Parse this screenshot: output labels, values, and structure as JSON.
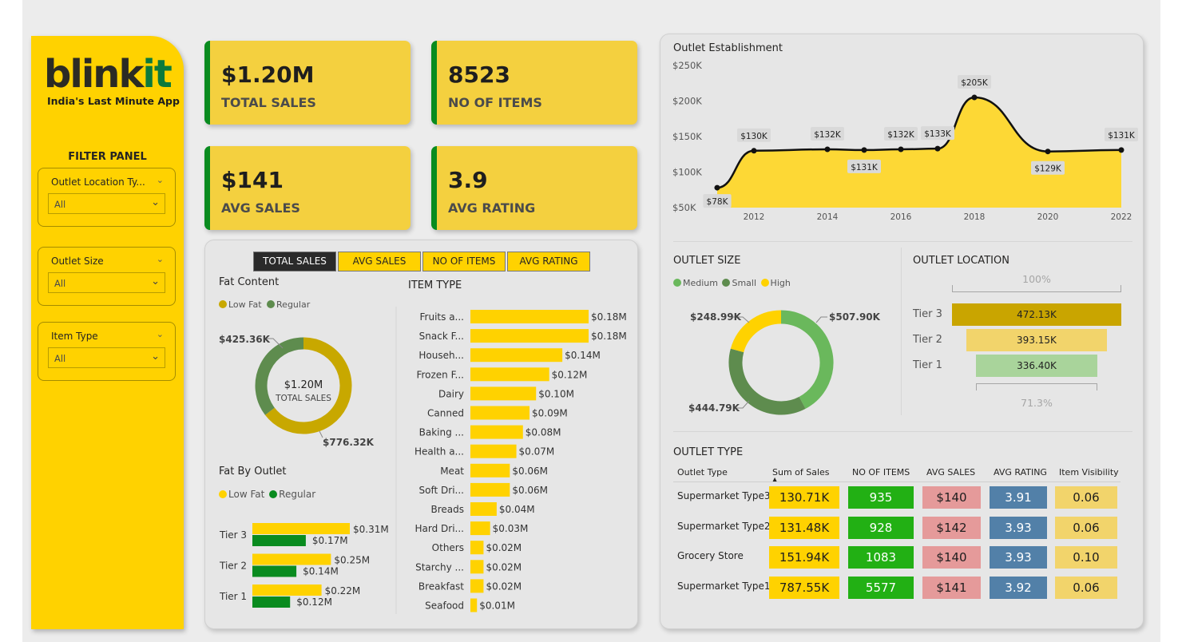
{
  "brand": {
    "logo_main": "blink",
    "logo_accent": "it",
    "tagline": "India's Last Minute App"
  },
  "filter_panel": {
    "title": "FILTER PANEL",
    "slicers": [
      {
        "label": "Outlet Location Ty...",
        "value": "All"
      },
      {
        "label": "Outlet Size",
        "value": "All"
      },
      {
        "label": "Item Type",
        "value": "All"
      }
    ]
  },
  "kpis": [
    {
      "value": "$1.20M",
      "label": "TOTAL SALES"
    },
    {
      "value": "8523",
      "label": "NO OF ITEMS"
    },
    {
      "value": "$141",
      "label": "AVG SALES"
    },
    {
      "value": "3.9",
      "label": "AVG RATING"
    }
  ],
  "tabs": [
    "TOTAL SALES",
    "AVG SALES",
    "NO OF ITEMS",
    "AVG RATING"
  ],
  "colors": {
    "yellow": "#ffd200",
    "olive": "#c8a800",
    "green": "#098b1f",
    "dark_green": "#5e8c4e",
    "light_green": "#6ab85c",
    "pink": "#e59a9a",
    "steel_blue": "#5280a8",
    "pale_yellow": "#f2d46b",
    "bright_green": "#22b014"
  },
  "fat_content": {
    "title": "Fat Content",
    "legend": [
      "Low Fat",
      "Regular"
    ],
    "center_value": "$1.20M",
    "center_label": "TOTAL SALES",
    "label_low_fat": "$776.32K",
    "label_regular": "$425.36K"
  },
  "fat_by_outlet": {
    "title": "Fat By Outlet",
    "legend": [
      "Low Fat",
      "Regular"
    ]
  },
  "item_type": {
    "title": "ITEM TYPE"
  },
  "outlet_establishment": {
    "title": "Outlet Establishment"
  },
  "outlet_size": {
    "title": "OUTLET SIZE",
    "legend": [
      "Medium",
      "Small",
      "High"
    ],
    "label_medium": "$507.90K",
    "label_small": "$444.79K",
    "label_high": "$248.99K"
  },
  "outlet_location": {
    "title": "OUTLET LOCATION",
    "top_pct": "100%",
    "bottom_pct": "71.3%",
    "tiers": [
      {
        "name": "Tier 3",
        "value_label": "472.13K",
        "value": 472.13,
        "color": "#c9a500"
      },
      {
        "name": "Tier 2",
        "value_label": "393.15K",
        "value": 393.15,
        "color": "#f2d46b"
      },
      {
        "name": "Tier 1",
        "value_label": "336.40K",
        "value": 336.4,
        "color": "#a9d49b"
      }
    ]
  },
  "outlet_type": {
    "title": "OUTLET TYPE",
    "headers": [
      "Outlet Type",
      "Sum of Sales",
      "NO OF ITEMS",
      "AVG SALES",
      "AVG RATING",
      "Item Visibility"
    ],
    "rows": [
      {
        "type": "Supermarket Type3",
        "sales": "130.71K",
        "items": "935",
        "avg_sales": "$140",
        "rating": "3.91",
        "visibility": "0.06"
      },
      {
        "type": "Supermarket Type2",
        "sales": "131.48K",
        "items": "928",
        "avg_sales": "$142",
        "rating": "3.93",
        "visibility": "0.06"
      },
      {
        "type": "Grocery Store",
        "sales": "151.94K",
        "items": "1083",
        "avg_sales": "$140",
        "rating": "3.93",
        "visibility": "0.10"
      },
      {
        "type": "Supermarket Type1",
        "sales": "787.55K",
        "items": "5577",
        "avg_sales": "$141",
        "rating": "3.92",
        "visibility": "0.06"
      }
    ]
  },
  "chart_data": [
    {
      "type": "line",
      "title": "Outlet Establishment",
      "x": [
        2011,
        2012,
        2014,
        2015,
        2016,
        2017,
        2018,
        2020,
        2022
      ],
      "values": [
        78,
        130,
        132,
        131,
        132,
        133,
        205,
        129,
        131
      ],
      "value_labels": [
        "$78K",
        "$130K",
        "$132K",
        "$131K",
        "$132K",
        "$133K",
        "$205K",
        "$129K",
        "$131K"
      ],
      "x_ticks": [
        "2012",
        "2014",
        "2016",
        "2018",
        "2020",
        "2022"
      ],
      "y_ticks": [
        "$250K",
        "$200K",
        "$150K",
        "$100K",
        "$50K"
      ],
      "ylim": [
        50,
        250
      ]
    },
    {
      "type": "bar",
      "title": "ITEM TYPE",
      "categories": [
        "Fruits a...",
        "Snack F...",
        "Househ...",
        "Frozen F...",
        "Dairy",
        "Canned",
        "Baking ...",
        "Health a...",
        "Meat",
        "Soft Dri...",
        "Breads",
        "Hard Dri...",
        "Others",
        "Starchy ...",
        "Breakfast",
        "Seafood"
      ],
      "values": [
        0.18,
        0.18,
        0.14,
        0.12,
        0.1,
        0.09,
        0.08,
        0.07,
        0.06,
        0.06,
        0.04,
        0.03,
        0.02,
        0.02,
        0.02,
        0.01
      ],
      "value_labels": [
        "$0.18M",
        "$0.18M",
        "$0.14M",
        "$0.12M",
        "$0.10M",
        "$0.09M",
        "$0.08M",
        "$0.07M",
        "$0.06M",
        "$0.06M",
        "$0.04M",
        "$0.03M",
        "$0.02M",
        "$0.02M",
        "$0.02M",
        "$0.01M"
      ]
    },
    {
      "type": "bar",
      "title": "Fat By Outlet",
      "categories": [
        "Tier 3",
        "Tier 2",
        "Tier 1"
      ],
      "series": [
        {
          "name": "Low Fat",
          "values": [
            0.31,
            0.25,
            0.22
          ],
          "labels": [
            "$0.31M",
            "$0.25M",
            "$0.22M"
          ]
        },
        {
          "name": "Regular",
          "values": [
            0.17,
            0.14,
            0.12
          ],
          "labels": [
            "$0.17M",
            "$0.14M",
            "$0.12M"
          ]
        }
      ]
    },
    {
      "type": "pie",
      "title": "Fat Content",
      "categories": [
        "Low Fat",
        "Regular"
      ],
      "values": [
        776.32,
        425.36
      ]
    },
    {
      "type": "pie",
      "title": "OUTLET SIZE",
      "categories": [
        "Medium",
        "Small",
        "High"
      ],
      "values": [
        507.9,
        444.79,
        248.99
      ]
    }
  ]
}
